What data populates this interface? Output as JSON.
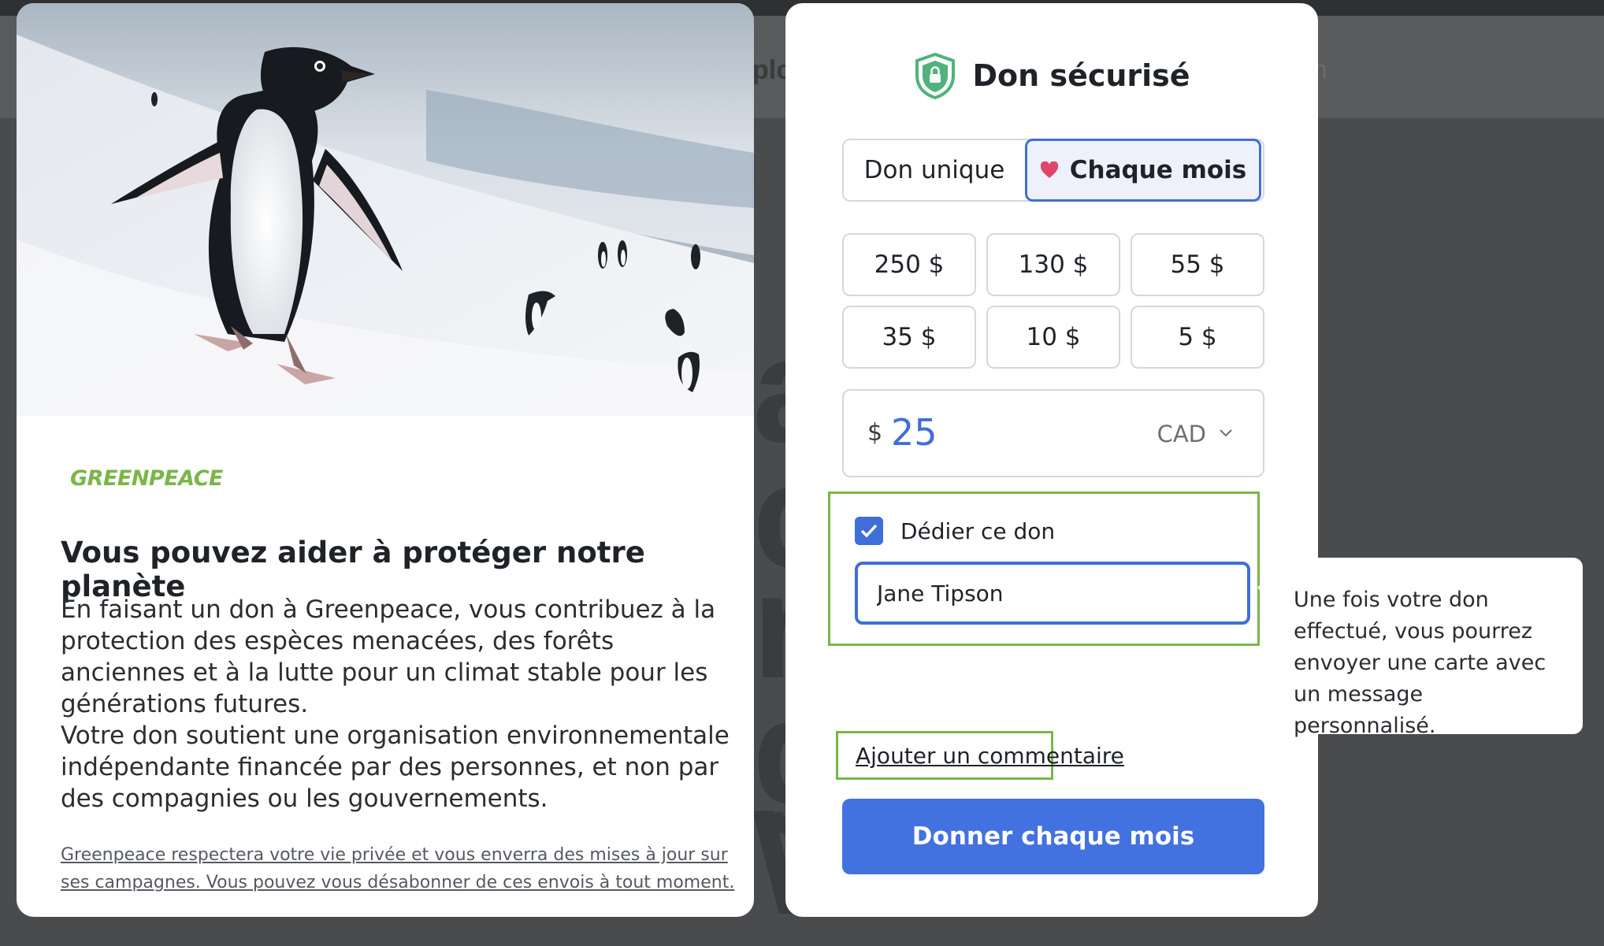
{
  "background": {
    "nav_fragment": "plo",
    "search_fragment": "rch",
    "headline_fragments": [
      "a",
      "c",
      "n",
      "g",
      "W"
    ]
  },
  "info_card": {
    "brand_logo_text": "GREENPEACE",
    "title": "Vous pouvez aider à protéger notre planète",
    "body_1": "En faisant un don à Greenpeace, vous contribuez à la protection des espèces menacées, des forêts anciennes et à la lutte pour un climat stable pour les générations futures.",
    "body_2": "Votre don soutient une organisation environnementale indépendante financée par des personnes, et non par des compagnies ou les gouvernements.",
    "privacy_note": "Greenpeace respectera votre vie privée et vous enverra des mises à jour sur ses campagnes. Vous pouvez vous désabonner de ces envois à tout moment."
  },
  "donation": {
    "header_title": "Don sécurisé",
    "frequency": {
      "once_label": "Don unique",
      "monthly_label": "Chaque mois",
      "selected": "monthly"
    },
    "amount_options": [
      "250 $",
      "130 $",
      "55 $",
      "35 $",
      "10 $",
      "5 $"
    ],
    "custom_amount": {
      "currency_symbol": "$",
      "value": "25",
      "currency_code": "CAD"
    },
    "dedicate": {
      "checked": true,
      "label": "Dédier ce don",
      "name_value": "Jane Tipson"
    },
    "comment_link": "Ajouter un commentaire",
    "submit_label": "Donner chaque mois"
  },
  "tooltip": {
    "text": "Une fois votre don effectué, vous pourrez envoyer une carte avec un message personnalisé."
  },
  "colors": {
    "accent_blue": "#4271e0",
    "highlight_green": "#7ab648",
    "shield_green": "#4fb37b",
    "heart_pink": "#e0456a"
  }
}
